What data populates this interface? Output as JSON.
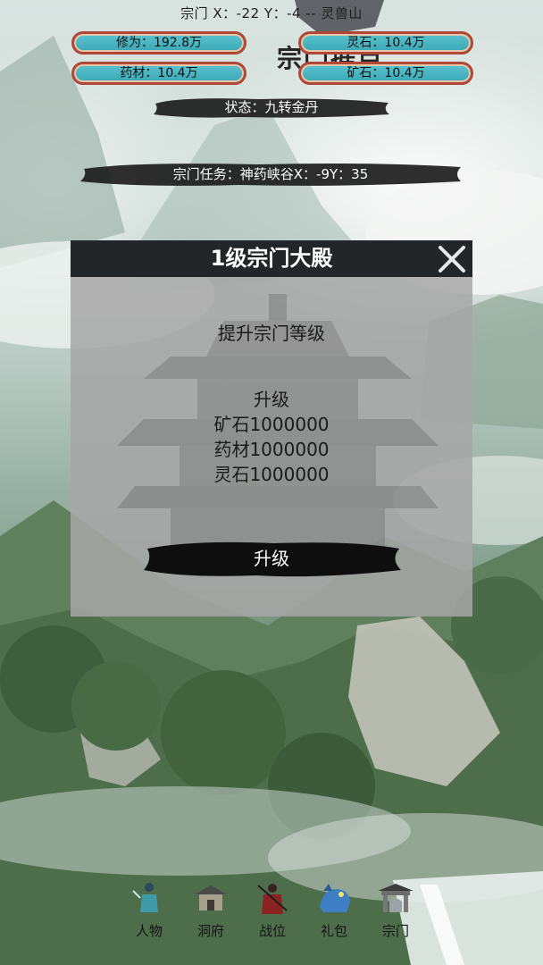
{
  "header": {
    "coord_text": "宗门 X：-22 Y：-4 -- 灵兽山",
    "bg_title": "宗门据点",
    "stats": [
      {
        "label": "修为：192.8万"
      },
      {
        "label": "灵石：10.4万"
      },
      {
        "label": "药材：10.4万"
      },
      {
        "label": "矿石：10.4万"
      }
    ],
    "status": "状态：九转金丹",
    "task": "宗门任务：神药峡谷X：-9Y：35"
  },
  "dialog": {
    "title": "1级宗门大殿",
    "subtitle": "提升宗门等级",
    "upgrade_heading": "升级",
    "requirements": [
      "矿石1000000",
      "药材1000000",
      "灵石1000000"
    ],
    "button_label": "升级"
  },
  "bottom_nav": [
    {
      "label": "人物",
      "icon": "character-icon"
    },
    {
      "label": "洞府",
      "icon": "cave-dwelling-icon"
    },
    {
      "label": "战位",
      "icon": "warrior-icon"
    },
    {
      "label": "礼包",
      "icon": "beast-gift-icon"
    },
    {
      "label": "宗门",
      "icon": "sect-gate-icon"
    }
  ],
  "colors": {
    "pill_fill": "#3aa7b5",
    "pill_border": "#b0483a",
    "dialog_header": "#232629",
    "dialog_body": "#a6a6a6"
  }
}
